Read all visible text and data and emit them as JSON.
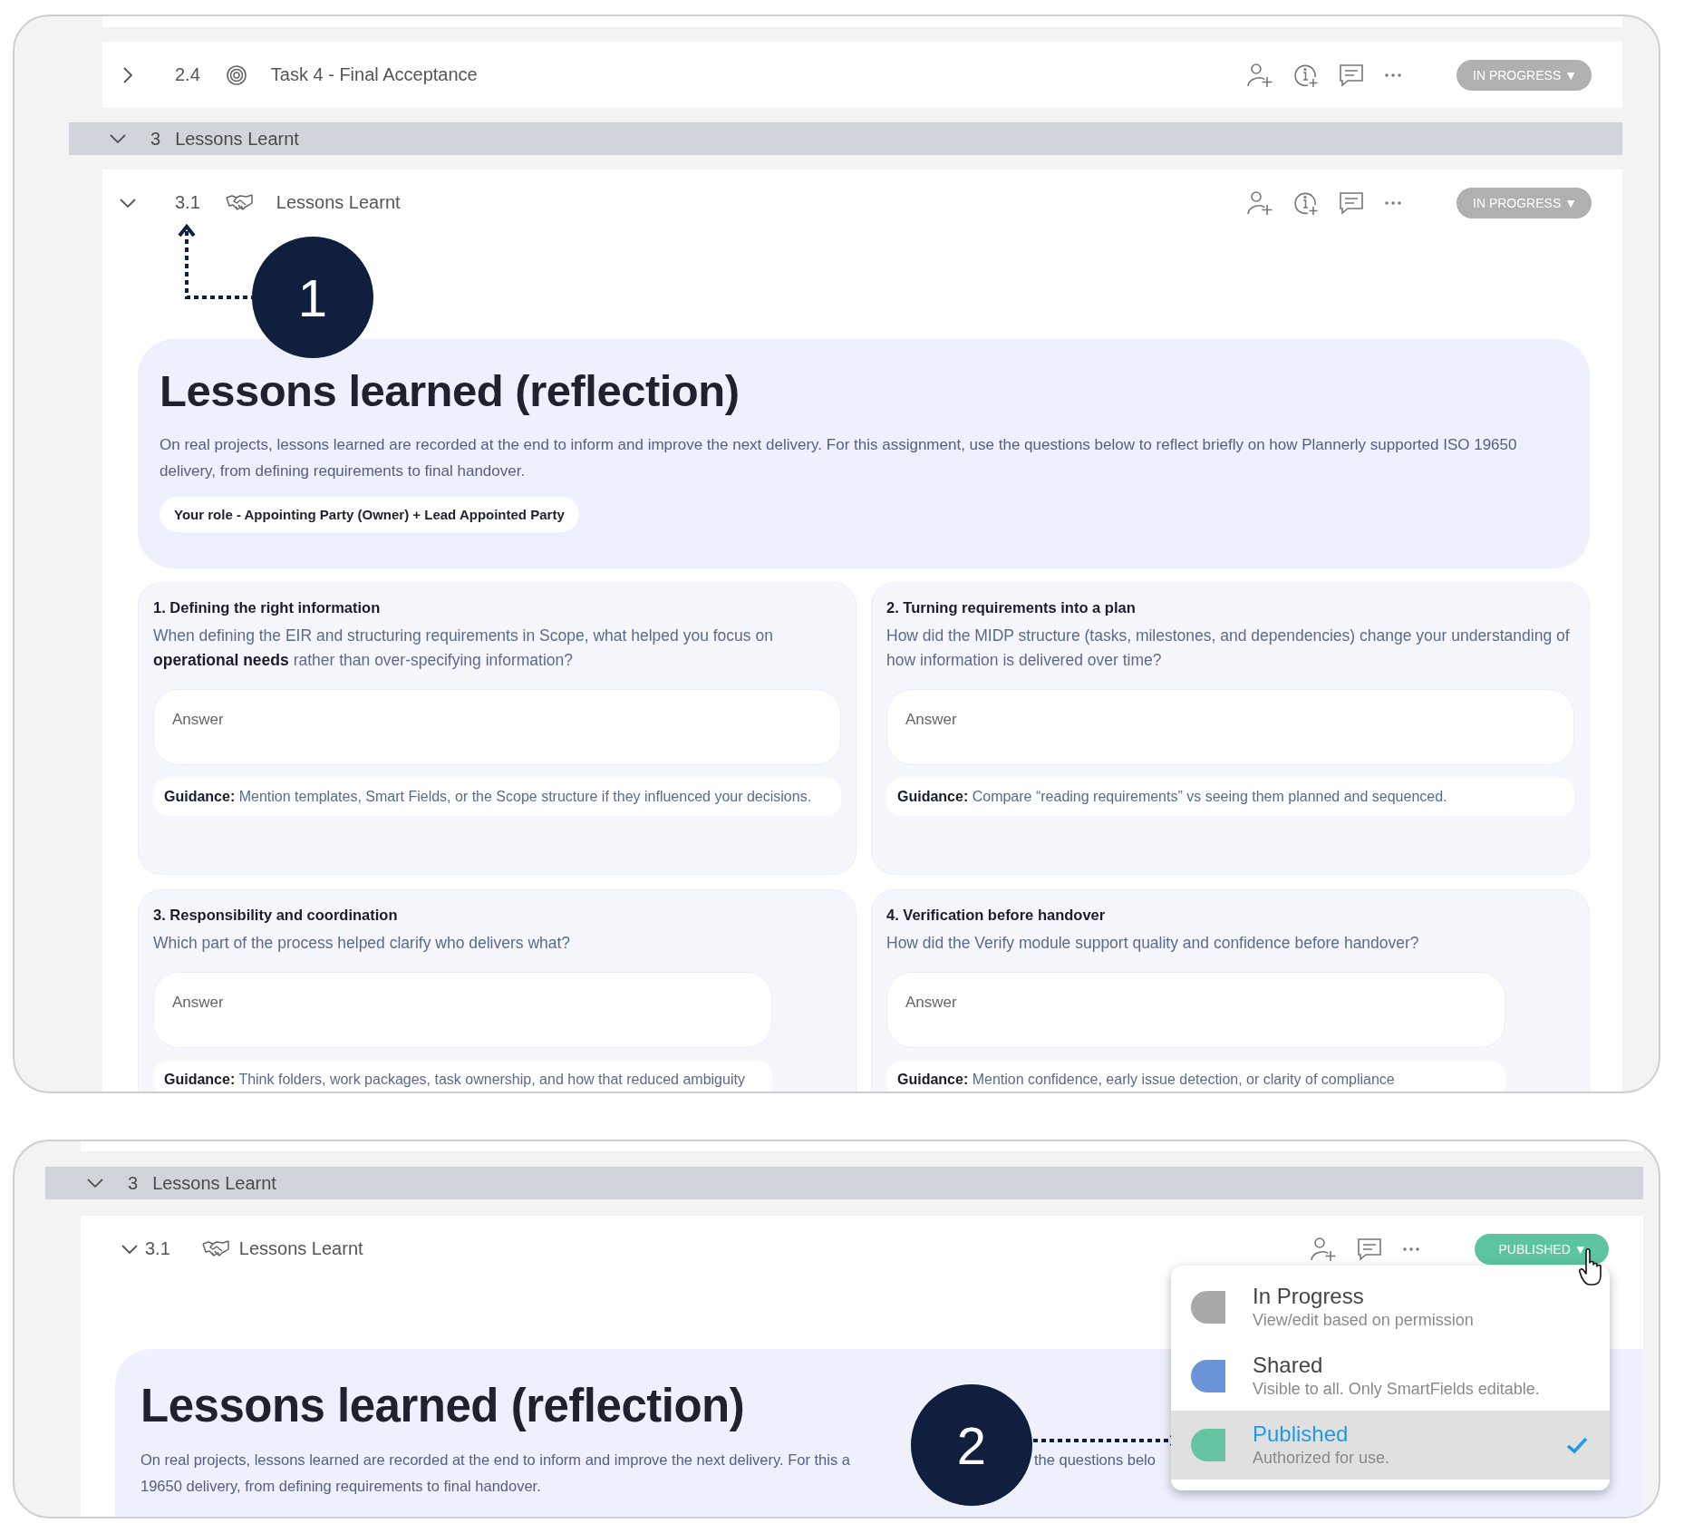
{
  "top_panel": {
    "previous_task": {
      "expanded": false,
      "number": "2.4",
      "title": "Task 4 - Final Acceptance",
      "actions": [
        {
          "kind": "assign"
        },
        {
          "kind": "info"
        },
        {
          "kind": "comment"
        },
        {
          "kind": "more"
        }
      ],
      "status": {
        "label": "IN PROGRESS ▼",
        "kind": "in_progress"
      }
    },
    "section": {
      "expanded": true,
      "number": "3",
      "title": "Lessons Learnt"
    },
    "task": {
      "expanded": true,
      "number": "3.1",
      "title": "Lessons Learnt",
      "actions": [
        {
          "kind": "assign"
        },
        {
          "kind": "info"
        },
        {
          "kind": "comment"
        },
        {
          "kind": "more"
        }
      ],
      "status": {
        "label": "IN PROGRESS ▼",
        "kind": "in_progress"
      }
    },
    "callout": {
      "label": "1"
    },
    "intro": {
      "title": "Lessons learned (reflection)",
      "text": "On real projects, lessons learned are recorded at the end to inform and improve the next delivery. For this assignment, use the questions below to reflect briefly on how Plannerly supported ISO 19650 delivery, from defining requirements to final handover.",
      "role": "Your role - Appointing Party (Owner) + Lead Appointed Party"
    },
    "questions": [
      {
        "title": "1. Defining the right information",
        "question": "When defining the EIR and structuring requirements in Scope, what helped you focus on **operational needs** rather than over-specifying information?",
        "placeholder": "Answer",
        "guidance": "**Guidance:** Mention templates, Smart Fields, or the Scope structure if they influenced your decisions."
      },
      {
        "title": "2. Turning requirements into a plan",
        "question": "How did the MIDP structure (tasks, milestones, and dependencies) change your understanding of how information is delivered over time?",
        "placeholder": "Answer",
        "guidance": "**Guidance:** Compare “reading requirements” vs seeing them planned and sequenced."
      },
      {
        "title": "3. Responsibility and coordination",
        "question": "Which part of the process helped clarify who delivers what?",
        "placeholder": "Answer",
        "guidance": "**Guidance:** Think folders, work packages, task ownership, and how that reduced ambiguity"
      },
      {
        "title": "4. Verification before handover",
        "question": "How did the Verify module support quality and confidence before handover?",
        "placeholder": "Answer",
        "guidance": "**Guidance:** Mention confidence, early issue detection, or clarity of compliance"
      }
    ]
  },
  "bottom_panel": {
    "section": {
      "expanded": true,
      "number": "3",
      "title": "Lessons Learnt"
    },
    "task": {
      "expanded": true,
      "number": "3.1",
      "title": "Lessons Learnt",
      "actions": [
        {
          "kind": "assign"
        },
        {
          "kind": "comment"
        },
        {
          "kind": "more"
        }
      ],
      "status": {
        "label": "PUBLISHED ▼",
        "kind": "published"
      }
    },
    "callout": {
      "label": "2"
    },
    "intro": {
      "title": "Lessons learned (reflection)",
      "text_fragments": [
        "On real projects, lessons learned are recorded at the end to inform and improve the next delivery. For this a",
        "the questions belo"
      ],
      "text_line_2": "19650 delivery, from defining requirements to final handover."
    },
    "status_menu": [
      {
        "title": "In Progress",
        "description": "View/edit based on permission",
        "color": "#a9a9a9",
        "selected": false
      },
      {
        "title": "Shared",
        "description": "Visible to all. Only SmartFields editable.",
        "color": "#6a93d8",
        "selected": false
      },
      {
        "title": "Published",
        "description": "Authorized for use.",
        "color": "#66c4a3",
        "selected": true
      }
    ]
  }
}
